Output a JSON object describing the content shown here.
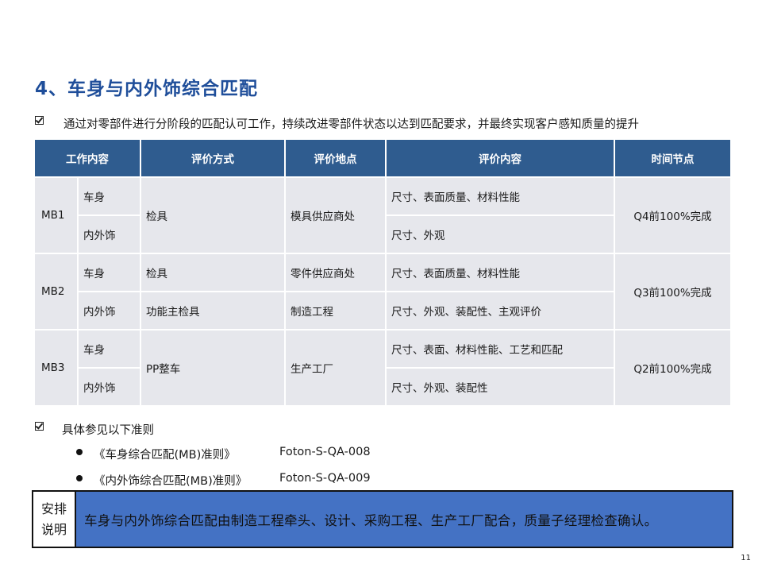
{
  "title": "4、车身与内外饰综合匹配",
  "intro": "通过对零部件进行分阶段的匹配认可工作，持续改进零部件状态以达到匹配要求，并最终实现客户感知质量的提升",
  "table": {
    "headers": [
      "工作内容",
      "评价方式",
      "评价地点",
      "评价内容",
      "时间节点"
    ],
    "groups": [
      {
        "id": "MB1",
        "rows": [
          {
            "part": "车身",
            "method": "检具",
            "place": "模具供应商处",
            "content": "尺寸、表面质量、材料性能"
          },
          {
            "part": "内外饰",
            "content": "尺寸、外观"
          }
        ],
        "deadline": "Q4前100%完成"
      },
      {
        "id": "MB2",
        "rows": [
          {
            "part": "车身",
            "method": "检具",
            "place": "零件供应商处",
            "content": "尺寸、表面质量、材料性能"
          },
          {
            "part": "内外饰",
            "method": "功能主检具",
            "place": "制造工程",
            "content": "尺寸、外观、装配性、主观评价"
          }
        ],
        "deadline": "Q3前100%完成"
      },
      {
        "id": "MB3",
        "rows": [
          {
            "part": "车身",
            "method": "PP整车",
            "place": "生产工厂",
            "content": "尺寸、表面、材料性能、工艺和匹配"
          },
          {
            "part": "内外饰",
            "content": "尺寸、外观、装配性"
          }
        ],
        "deadline": "Q2前100%完成"
      }
    ]
  },
  "references": {
    "heading": "具体参见以下准则",
    "items": [
      {
        "name": "《车身综合匹配(MB)准则》",
        "code": "Foton-S-QA-008"
      },
      {
        "name": "《内外饰综合匹配(MB)准则》",
        "code": "Foton-S-QA-009"
      }
    ]
  },
  "note": {
    "label_line1": "安排",
    "label_line2": "说明",
    "text": "车身与内外饰综合匹配由制造工程牵头、设计、采购工程、生产工厂配合，质量子经理检查确认。"
  },
  "page_number": "11"
}
